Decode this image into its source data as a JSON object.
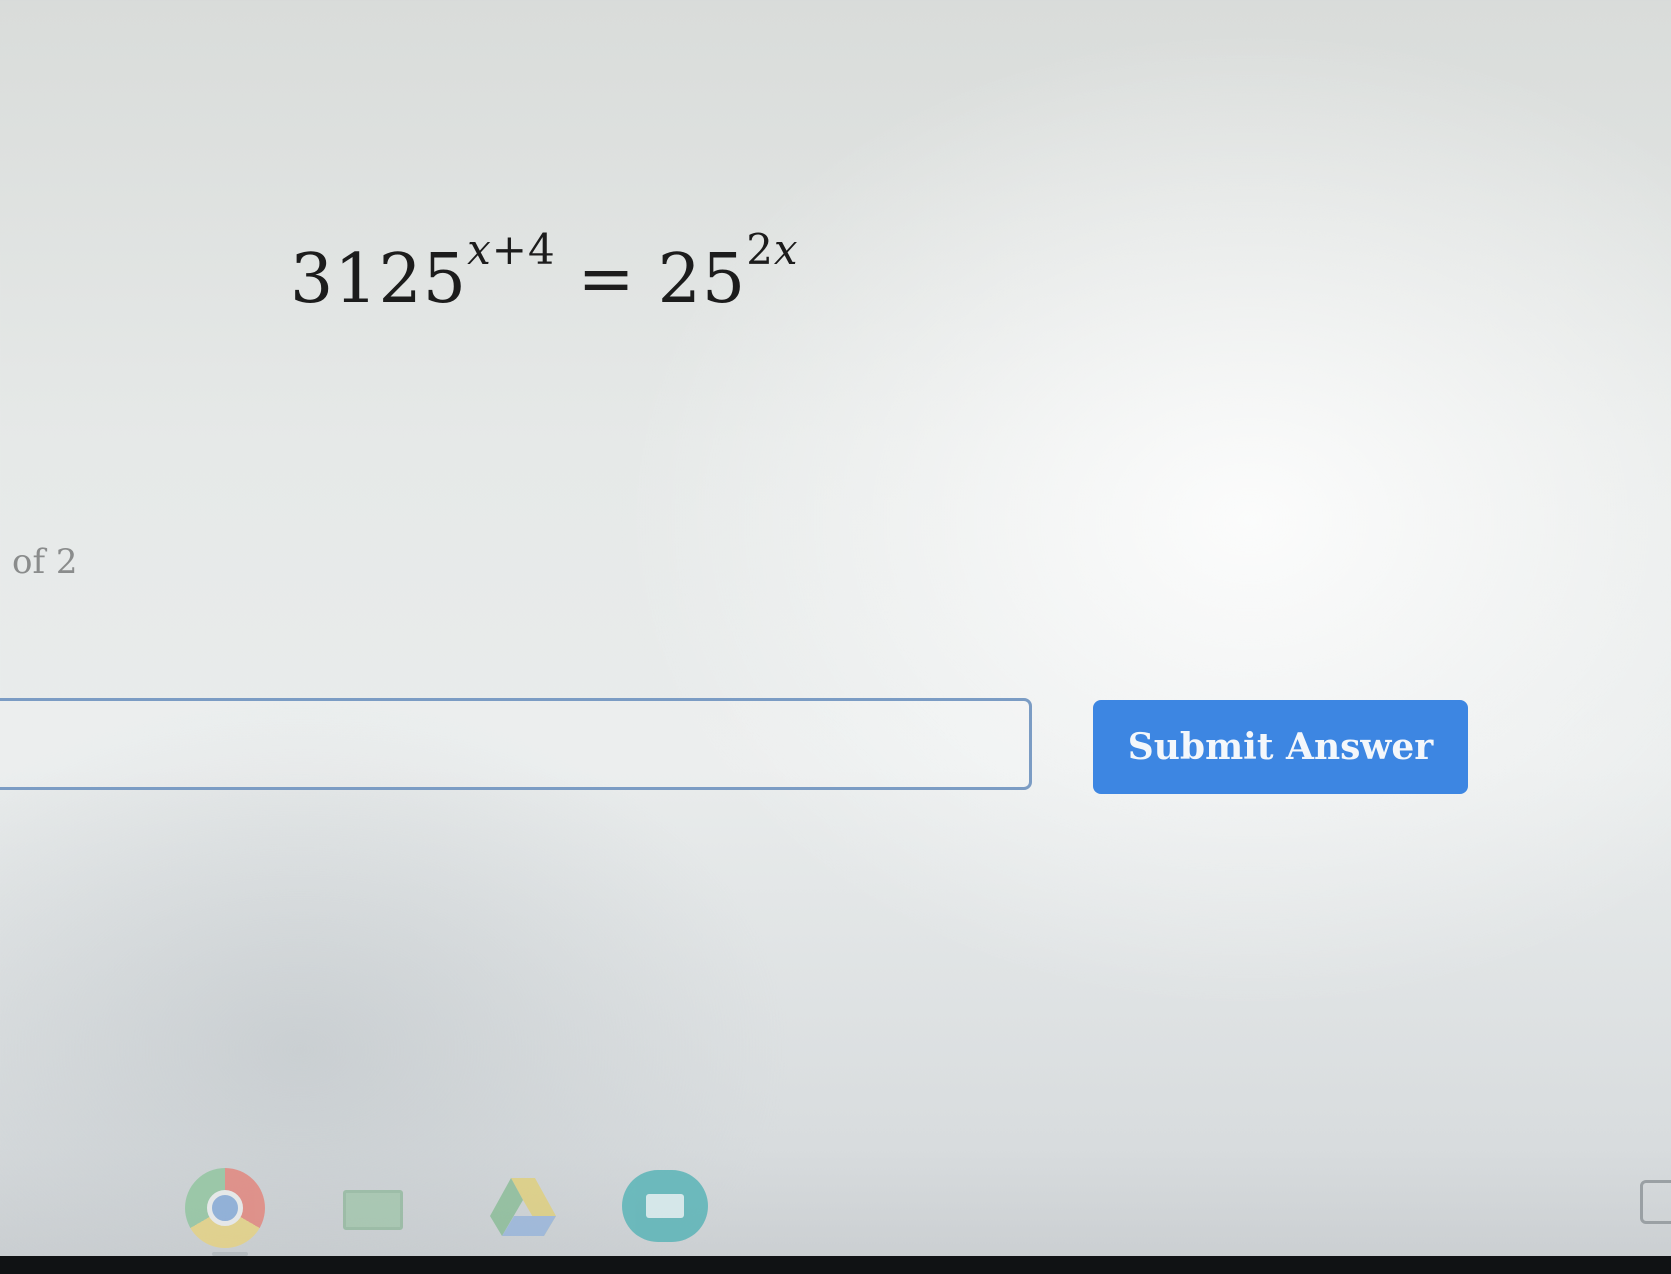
{
  "question": {
    "equation": {
      "left_base": "3125",
      "left_exponent": {
        "variable": "x",
        "rest": "+4"
      },
      "equals": "=",
      "right_base": "25",
      "right_exponent": {
        "coefficient": "2",
        "variable": "x"
      }
    },
    "counter": "of 2"
  },
  "answer": {
    "input_value": "",
    "placeholder": "",
    "submit_label": "Submit Answer"
  },
  "shelf": {
    "icons": [
      "chrome-icon",
      "google-classroom-icon",
      "google-drive-icon",
      "google-meet-icon",
      "tray-icon"
    ]
  },
  "colors": {
    "submit_button": "#3d86e2",
    "input_border": "#7b9cc4"
  }
}
